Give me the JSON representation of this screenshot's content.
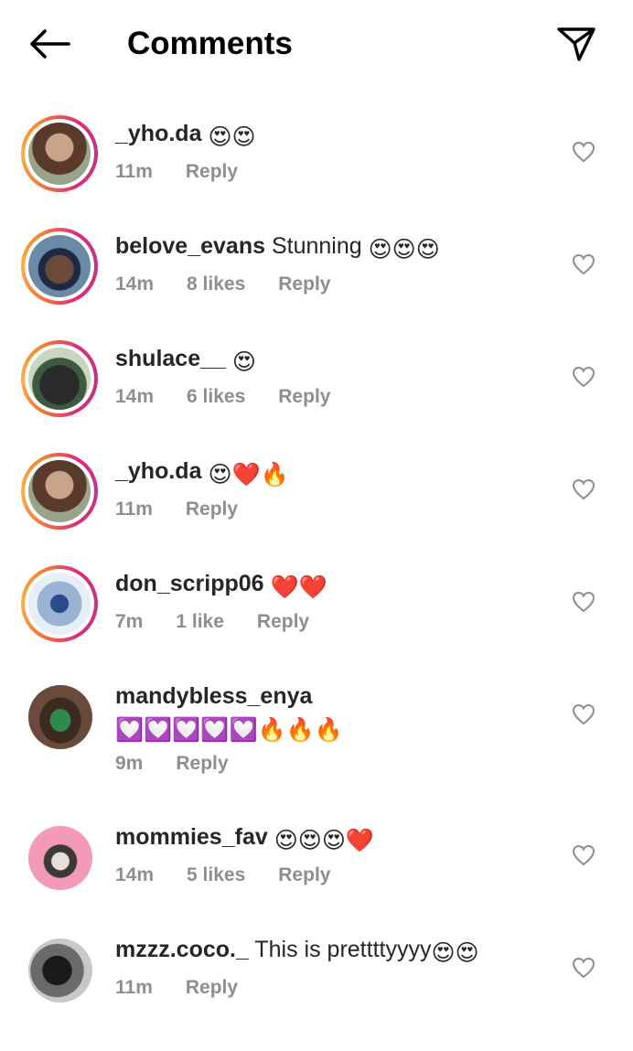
{
  "header": {
    "title": "Comments",
    "back_icon": "arrow-left-icon",
    "send_icon": "paper-plane-icon"
  },
  "colors": {
    "meta_gray": "#8e8e8e",
    "ring_start": "#f77737",
    "ring_end": "#c13584"
  },
  "comments": [
    {
      "username": "_yho.da",
      "text": "",
      "emojis": "😍😍",
      "time": "11m",
      "likes": "",
      "reply": "Reply"
    },
    {
      "username": "belove_evans",
      "text": " Stunning ",
      "emojis": "😍😍😍",
      "time": "14m",
      "likes": "8 likes",
      "reply": "Reply"
    },
    {
      "username": "shulace__",
      "text": " ",
      "emojis": "😍",
      "time": "14m",
      "likes": "6 likes",
      "reply": "Reply"
    },
    {
      "username": "_yho.da",
      "text": " ",
      "emojis": "😍❤️🔥",
      "time": "11m",
      "likes": "",
      "reply": "Reply"
    },
    {
      "username": "don_scripp06",
      "text": " ",
      "emojis": "❤️❤️",
      "time": "7m",
      "likes": "1 like",
      "reply": "Reply"
    },
    {
      "username": "mandybless_enya",
      "text": " ",
      "emojis": "💟💟💟💟💟🔥🔥🔥",
      "time": "9m",
      "likes": "",
      "reply": "Reply"
    },
    {
      "username": "mommies_fav",
      "text": " ",
      "emojis": "😍😍😍❤️",
      "time": "14m",
      "likes": "5 likes",
      "reply": "Reply"
    },
    {
      "username": "mzzz.coco._",
      "text": " This is prettttyyyy",
      "emojis": "😍😍",
      "time": "11m",
      "likes": "",
      "reply": "Reply"
    }
  ]
}
